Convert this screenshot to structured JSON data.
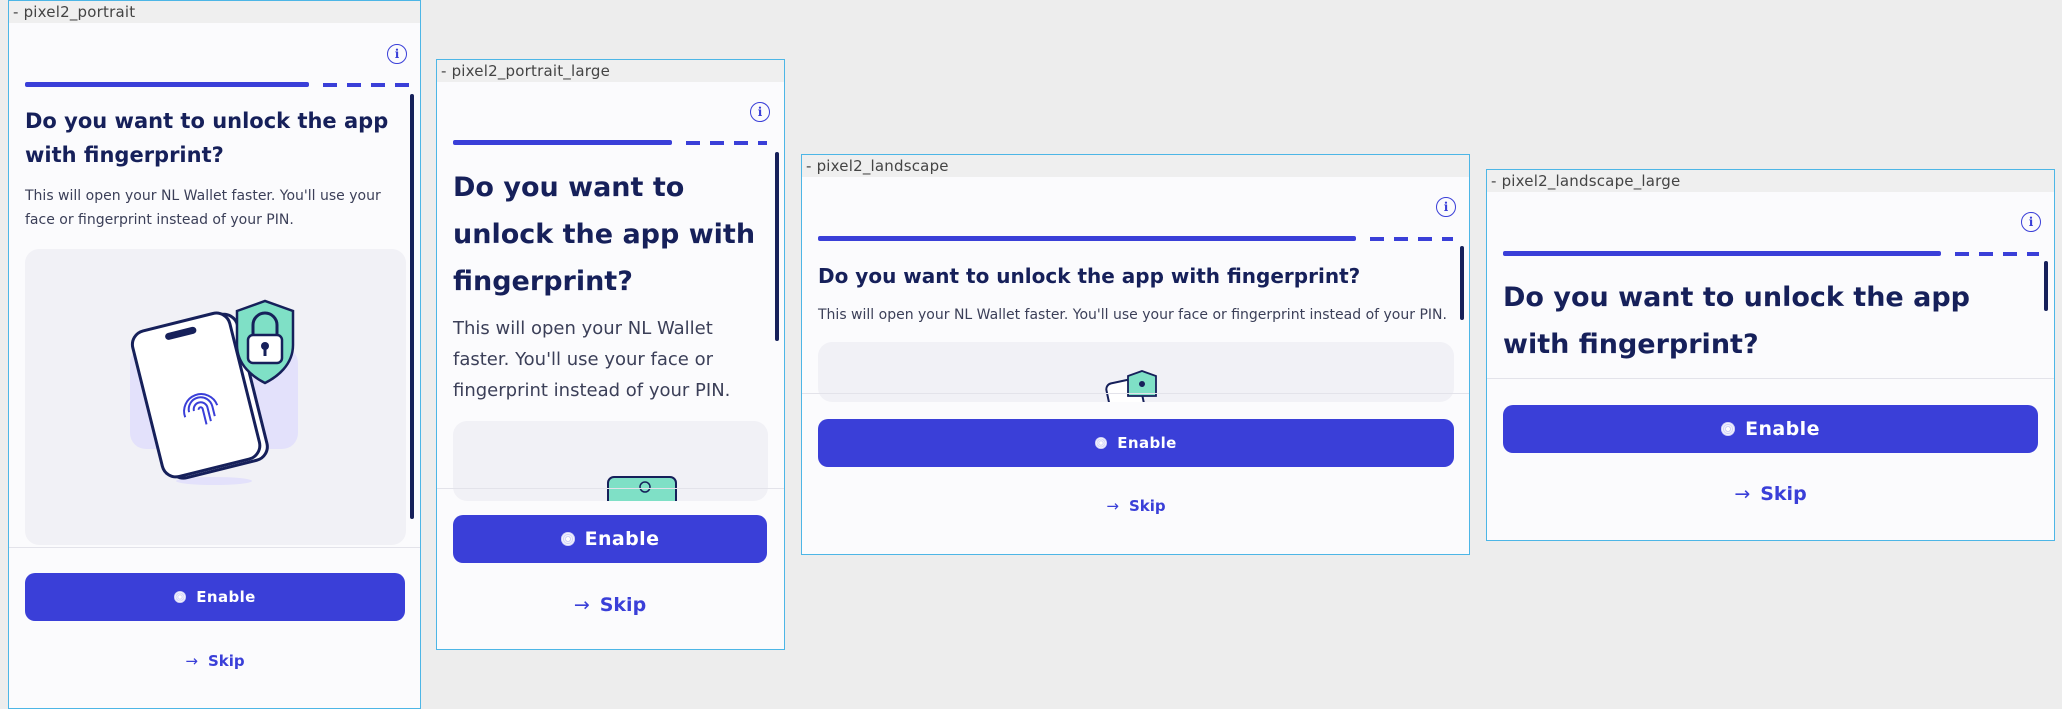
{
  "screen": {
    "title": "Do you want to unlock the app with fingerprint?",
    "description": "This will open your NL Wallet faster. You'll use your face or fingerprint instead of your PIN.",
    "enable_label": "Enable",
    "skip_label": "Skip",
    "progress": 0.8,
    "icons": {
      "info": "info-icon",
      "enable": "fingerprint-icon",
      "skip": "arrow-right-icon"
    }
  },
  "variants": [
    {
      "label": "- pixel2_portrait"
    },
    {
      "label": "- pixel2_portrait_large"
    },
    {
      "label": "- pixel2_landscape"
    },
    {
      "label": "- pixel2_landscape_large"
    }
  ],
  "colors": {
    "primary": "#3a3fd8",
    "title": "#16205a",
    "background": "#fbfbfd",
    "page_background": "#ededed",
    "frame_border": "#4db6e6",
    "illustration_mint": "#7fe0c6",
    "illustration_lavender": "#e3e1fb"
  }
}
